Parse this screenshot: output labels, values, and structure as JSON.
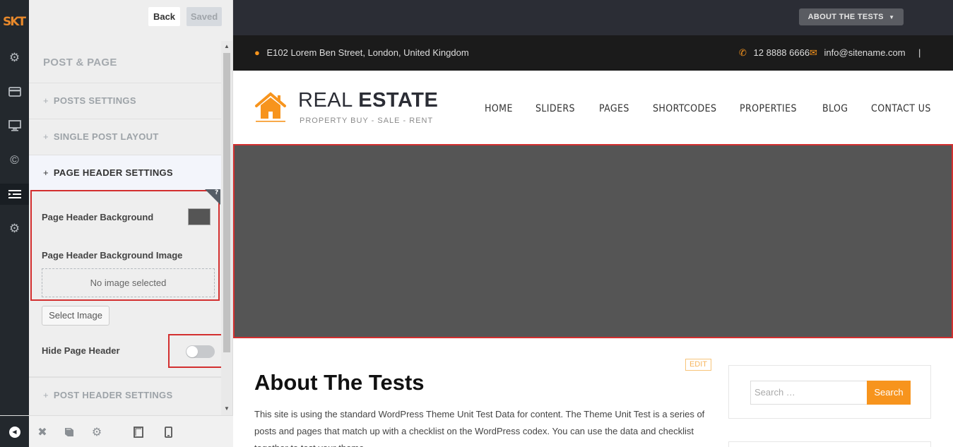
{
  "rail": {
    "logo": "SKT",
    "icons": [
      "gear-icon",
      "credit-card-icon",
      "monitor-icon",
      "copyright-icon",
      "list-icon",
      "gear-icon"
    ]
  },
  "panel": {
    "back_label": "Back",
    "saved_label": "Saved",
    "title": "POST & PAGE",
    "sections": {
      "posts_settings": "POSTS SETTINGS",
      "single_post_layout": "SINGLE POST LAYOUT",
      "page_header_settings": "PAGE HEADER SETTINGS",
      "post_header_settings": "POST HEADER SETTINGS"
    },
    "plus": "+",
    "help": "?",
    "controls": {
      "bg_label": "Page Header Background",
      "bg_color": "#555555",
      "bg_image_label": "Page Header Background Image",
      "no_image": "No image selected",
      "select_image": "Select Image",
      "hide_label": "Hide Page Header",
      "hide_on": false
    }
  },
  "bottombar": {
    "icons": [
      "collapse-icon",
      "close-icon",
      "book-icon",
      "gear-icon",
      "tablet-icon",
      "mobile-icon"
    ]
  },
  "site": {
    "top_dropdown": "ABOUT THE TESTS",
    "address": "E102 Lorem Ben Street, London, United Kingdom",
    "phone": "12 8888 6666",
    "email": "info@sitename.com",
    "separator": "|",
    "brand_light": "REAL ",
    "brand_bold": "ESTATE",
    "tagline": "PROPERTY BUY - SALE - RENT",
    "nav": [
      "HOME",
      "SLIDERS",
      "PAGES",
      "SHORTCODES",
      "PROPERTIES",
      "BLOG",
      "CONTACT US"
    ],
    "banner_color": "#555555",
    "edit_label": "EDIT",
    "post_title": "About The Tests",
    "post_body": "This site is using the standard WordPress Theme Unit Test Data for content. The Theme Unit Test is a series of posts and pages that match up with a checklist on the WordPress codex. You can use the data and checklist together to test your theme.",
    "search_placeholder": "Search …",
    "search_button": "Search",
    "accent": "#f7941d"
  }
}
